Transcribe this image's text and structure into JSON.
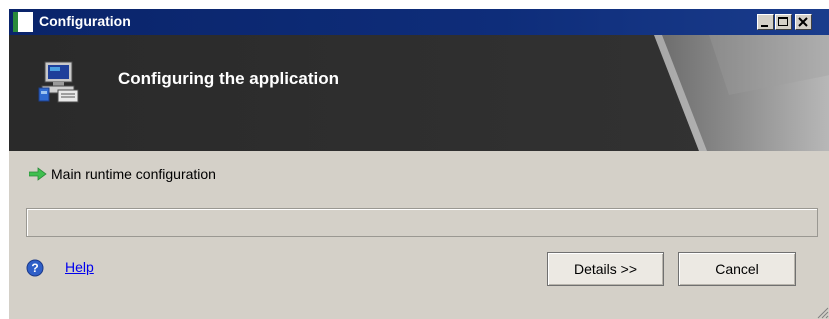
{
  "window": {
    "title": "Configuration",
    "controls": {
      "minimize": "minimize",
      "maximize": "maximize",
      "close": "close"
    }
  },
  "banner": {
    "title": "Configuring the application",
    "icon": "computer-setup-icon"
  },
  "step": {
    "label": "Main runtime configuration",
    "icon": "green-arrow-icon"
  },
  "progress": {
    "value": 0
  },
  "help": {
    "label": "Help",
    "icon": "question-icon"
  },
  "buttons": {
    "details": "Details >>",
    "cancel": "Cancel"
  },
  "colors": {
    "titlebar": "#0a246a",
    "banner": "#2e2e2e",
    "dialog": "#d4d0c8",
    "accent_green": "#2a8a3a",
    "link": "#0000ee"
  }
}
